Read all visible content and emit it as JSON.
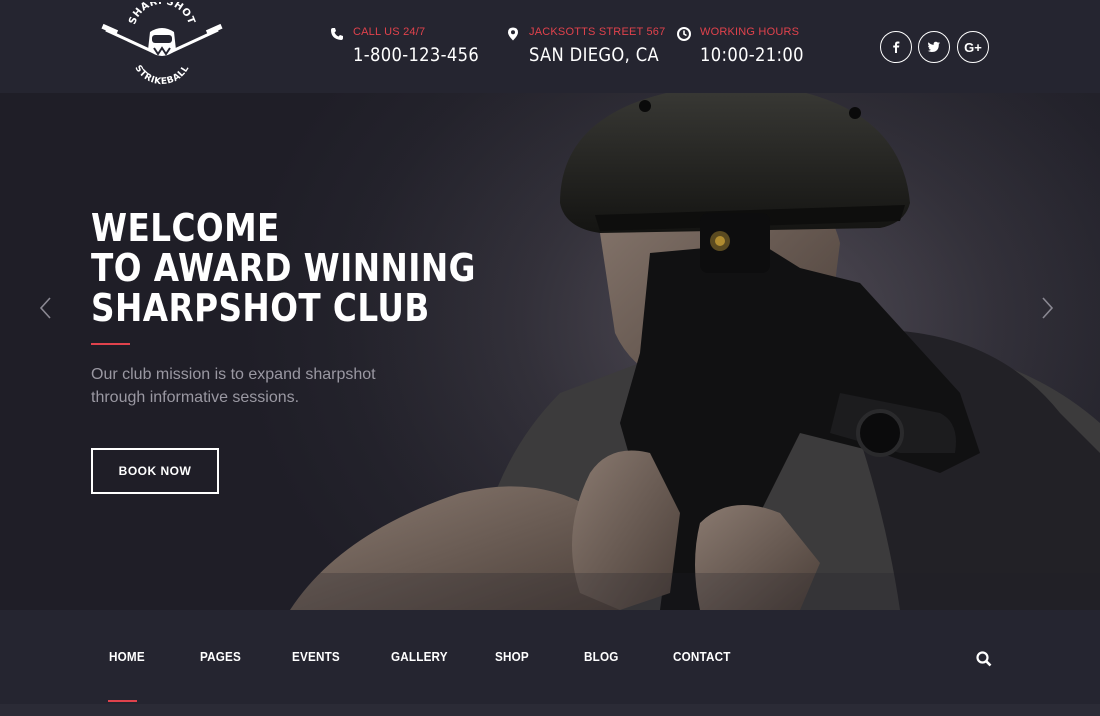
{
  "brand": {
    "logo_top_text": "SHARPSHOT",
    "logo_bottom_text": "STRIKEBALL"
  },
  "header": {
    "call": {
      "icon": "phone-icon",
      "label": "CALL US 24/7",
      "value": "1-800-123-456"
    },
    "address": {
      "icon": "map-pin-icon",
      "label": "JACKSOTTS STREET 567",
      "value": "SAN DIEGO, CA"
    },
    "hours": {
      "icon": "clock-icon",
      "label": "WORKING HOURS",
      "value": "10:00-21:00"
    },
    "social": [
      {
        "icon": "facebook-icon"
      },
      {
        "icon": "twitter-icon"
      },
      {
        "icon": "google-plus-icon",
        "text": "G+"
      }
    ]
  },
  "hero": {
    "title_lines": [
      "WELCOME",
      "TO AWARD WINNING",
      "SHARPSHOT CLUB"
    ],
    "text_lines": [
      "Our club mission is to expand sharpshot",
      "through informative sessions."
    ],
    "button_label": "BOOK NOW",
    "prev_icon": "chevron-left-icon",
    "next_icon": "chevron-right-icon"
  },
  "nav": {
    "items": [
      "HOME",
      "PAGES",
      "EVENTS",
      "GALLERY",
      "SHOP",
      "BLOG",
      "CONTACT"
    ],
    "active": "HOME",
    "search_icon": "search-icon"
  },
  "colors": {
    "accent": "#e0424c",
    "header_bg": "#252530",
    "hero_bg": "#2a2932",
    "text_muted": "#9a98a2"
  }
}
